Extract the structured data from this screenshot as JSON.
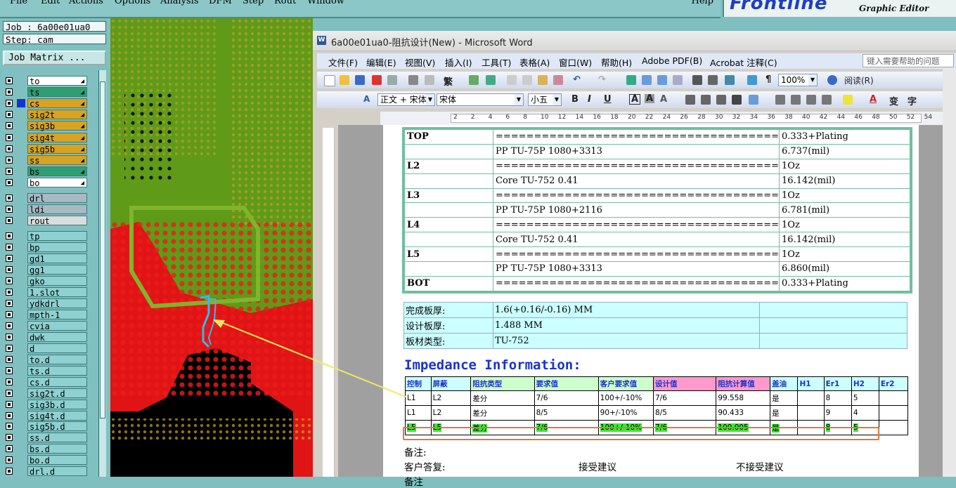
{
  "cad": {
    "menu": [
      "File",
      "Edit",
      "Actions",
      "Options",
      "Analysis",
      "DFM",
      "Step",
      "Rout",
      "Window"
    ],
    "help": "Help",
    "logo": "Frontline",
    "subtitle": "Graphic Editor",
    "job_label": "Job : 6a00e01ua0",
    "step_label": "Step: cam",
    "job_matrix": "Job Matrix ...",
    "layers_group1": [
      {
        "name": "to",
        "color": "#ffffff"
      },
      {
        "name": "ts",
        "color": "#2f9f72"
      },
      {
        "name": "cs",
        "color": "#d8a320"
      },
      {
        "name": "sig2t",
        "color": "#d8a320"
      },
      {
        "name": "sig3b",
        "color": "#d8a320"
      },
      {
        "name": "sig4t",
        "color": "#d8a320"
      },
      {
        "name": "sig5b",
        "color": "#d8a320"
      },
      {
        "name": "ss",
        "color": "#d8a320"
      },
      {
        "name": "bs",
        "color": "#2f9f72"
      },
      {
        "name": "bo",
        "color": "#ffffff"
      }
    ],
    "layers_group2": [
      "drl",
      "ldi",
      "rout"
    ],
    "layers_group3": [
      "tp",
      "bp",
      "gd1",
      "gg1",
      "gko",
      "1.slot",
      "ydkdrl",
      "mpth-1",
      "cvia",
      "dwk",
      "d",
      "to.d",
      "ts.d",
      "cs.d",
      "sig2t.d",
      "sig3b.d",
      "sig4t.d",
      "sig5b.d",
      "ss.d",
      "bs.d",
      "bo.d",
      "drl.d"
    ]
  },
  "word": {
    "title": "6a00e01ua0-阻抗设计(New) - Microsoft Word",
    "menu": [
      "文件(F)",
      "编辑(E)",
      "视图(V)",
      "插入(I)",
      "工具(T)",
      "表格(A)",
      "窗口(W)",
      "帮助(H)",
      "Adobe PDF(B)",
      "Acrobat 注释(C)"
    ],
    "help_placeholder": "键入需要帮助的问题",
    "zoom": "100%",
    "read_mode": "阅读(R)",
    "style": "正文 + 宋体",
    "font": "宋体",
    "size": "小五",
    "ruler_numbers": [
      "2",
      "2",
      "4",
      "6",
      "8",
      "10",
      "12",
      "14",
      "16",
      "18",
      "20",
      "22",
      "24",
      "26",
      "28",
      "30",
      "32",
      "34",
      "36",
      "38",
      "40",
      "42",
      "44",
      "46",
      "48",
      "50",
      "52",
      "54"
    ],
    "stackup": [
      {
        "layer": "TOP",
        "material": "=====================================",
        "value": "0.333+Plating"
      },
      {
        "layer": "",
        "material": "PP     TU-75P     1080+3313",
        "value": "6.737(mil)"
      },
      {
        "layer": "L2",
        "material": "=====================================",
        "value": "1Oz"
      },
      {
        "layer": "",
        "material": "Core     TU-752     0.41",
        "value": "16.142(mil)"
      },
      {
        "layer": "L3",
        "material": "=====================================",
        "value": "1Oz"
      },
      {
        "layer": "",
        "material": "PP     TU-75P     1080+2116",
        "value": "6.781(mil)"
      },
      {
        "layer": "L4",
        "material": "=====================================",
        "value": "1Oz"
      },
      {
        "layer": "",
        "material": "Core     TU-752     0.41",
        "value": "16.142(mil)"
      },
      {
        "layer": "L5",
        "material": "=====================================",
        "value": "1Oz"
      },
      {
        "layer": "",
        "material": "PP     TU-75P     1080+3313",
        "value": "6.860(mil)"
      },
      {
        "layer": "BOT",
        "material": "=====================================",
        "value": "0.333+Plating"
      }
    ],
    "board_info": [
      {
        "label": "完成板厚:",
        "value": "1.6(+0.16/-0.16) MM"
      },
      {
        "label": "设计板厚:",
        "value": "1.488 MM"
      },
      {
        "label": "板材类型:",
        "value": "TU-752"
      }
    ],
    "impedance_heading": "Impedance Information:",
    "impedance_headers": [
      "控制",
      "屏蔽",
      "阻抗类型",
      "要求值",
      "客户要求值",
      "设计值",
      "阻抗计算值",
      "盖油",
      "H1",
      "Er1",
      "H2",
      "Er2"
    ],
    "impedance_rows": [
      [
        "L1",
        "L2",
        "差分",
        "7/6",
        "100+/-10%",
        "7/6",
        "99.558",
        "是",
        "",
        "8",
        "5",
        ""
      ],
      [
        "L1",
        "L2",
        "差分",
        "8/5",
        "90+/-10%",
        "8/5",
        "90.433",
        "是",
        "",
        "9",
        "4",
        ""
      ],
      [
        "L5",
        "L5",
        "差分",
        "7/6",
        "100+/-10%",
        "7/6",
        "100.005",
        "是",
        "",
        "8",
        "5",
        ""
      ]
    ],
    "remark": "备注:",
    "reply_label": "客户答复:",
    "accept": "接受建议",
    "reject": "不接受建议",
    "bottom_cut": "备注"
  }
}
